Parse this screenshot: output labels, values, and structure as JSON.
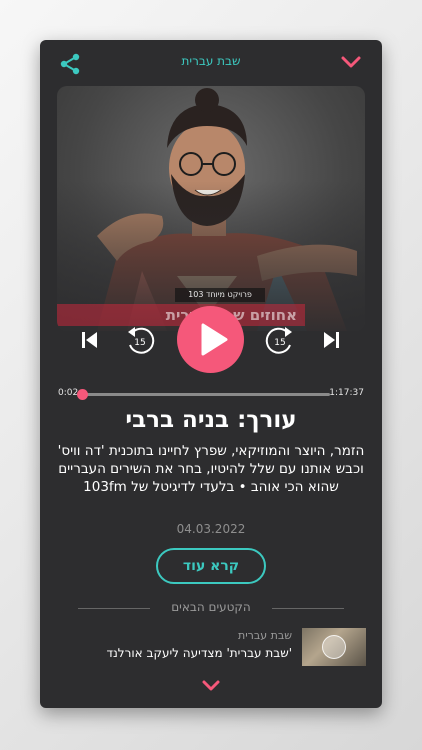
{
  "header": {
    "title": "שבת עברית",
    "share_icon": "share-icon",
    "collapse_icon": "chevron-down-icon"
  },
  "artwork": {
    "badge_text": "פרויקט מיוחד 103",
    "strip_text": "אחוזים שבת עברית"
  },
  "player": {
    "skip_back_seconds": "15",
    "skip_forward_seconds": "15",
    "elapsed": "0:02",
    "total": "1:17:37",
    "progress_fraction": 0.0004,
    "accent_color": "#f5587a"
  },
  "episode": {
    "title": "עורך: בניה ברבי",
    "description": "הזמר, היוצר והמוזיקאי, שפרץ לחיינו בתוכנית 'דה וויס' וכבש אותנו עם שלל להיטיו, בחר את השירים העבריים שהוא הכי אוהב • בלעדי לדיגיטל של 103fm",
    "date": "04.03.2022",
    "read_more_label": "קרא עוד"
  },
  "next_section": {
    "label": "הקטעים הבאים",
    "items": [
      {
        "category": "שבת עברית",
        "title": "'שבת עברית' מצדיעה ליעקב אורלנד"
      }
    ]
  },
  "colors": {
    "teal": "#3cc9c0",
    "pink": "#f5587a",
    "panel": "#2d2d2f"
  }
}
